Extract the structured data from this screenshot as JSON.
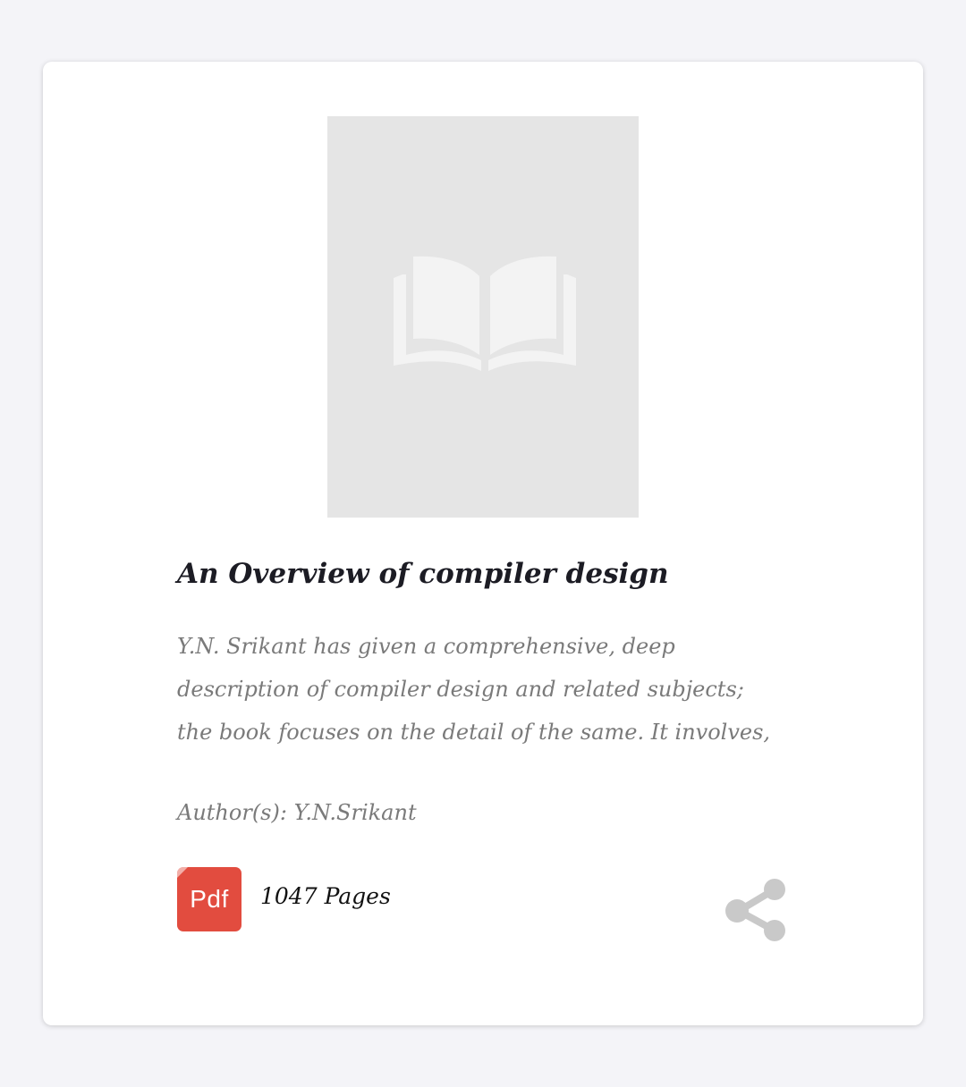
{
  "book": {
    "cover_icon": "open-book-icon",
    "title": "An Overview of compiler design",
    "description_lines": [
      "Y.N. Srikant has given a comprehensive, deep",
      "description of compiler design and related subjects;",
      "the book focuses on the detail of the same. It involves,"
    ],
    "authors": "Author(s): Y.N.Srikant",
    "file_badge": "Pdf",
    "pages": "1047 Pages",
    "share_icon": "share-icon"
  },
  "colors": {
    "page_background": "#f4f4f8",
    "card_background": "#ffffff",
    "cover_placeholder": "#e5e5e5",
    "title_text": "#1c1c24",
    "muted_text": "#7a7a7a",
    "pdf_badge": "#e24c3f",
    "share_icon": "#c9c9c9"
  }
}
